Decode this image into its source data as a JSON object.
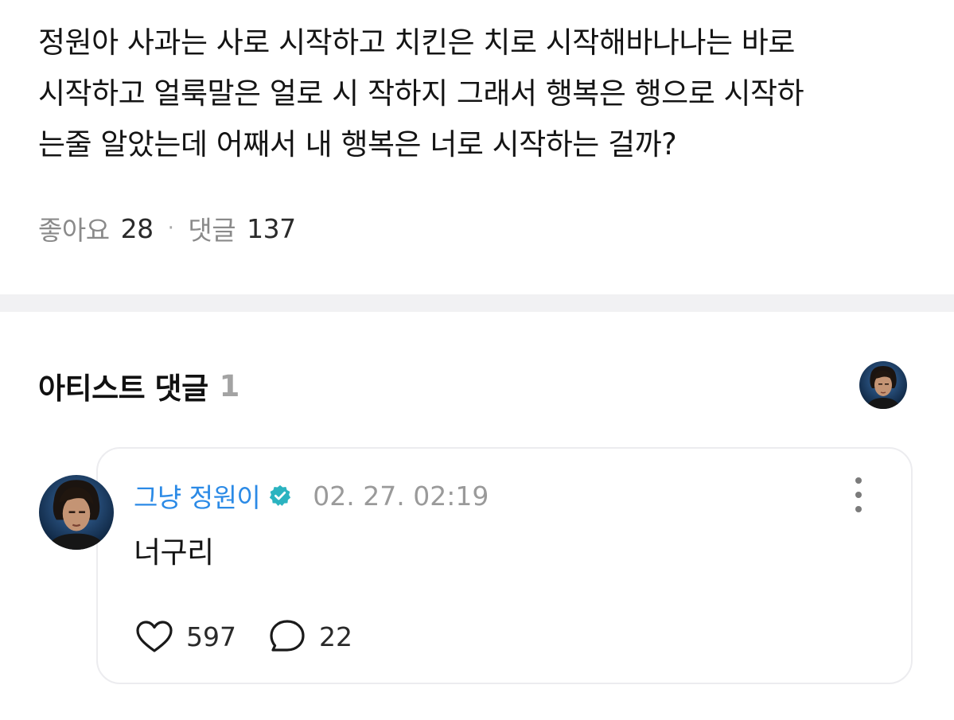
{
  "post": {
    "lines": [
      "정원아 사과는 사로 시작하고 치킨은 치로 시작해바나나는 바로",
      "시작하고 얼룩말은 얼로 시 작하지 그래서 행복은 행으로 시작하",
      "는줄 알았는데 어째서 내 행복은 너로 시작하는 걸까?"
    ],
    "likes_label": "좋아요",
    "likes_count": "28",
    "separator": "·",
    "comments_label": "댓글",
    "comments_count": "137"
  },
  "artist_section": {
    "title": "아티스트 댓글",
    "count": "1"
  },
  "comment": {
    "author": "그냥 정원이",
    "verified_icon": "verified-badge-icon",
    "timestamp": "02. 27. 02:19",
    "text": "너구리",
    "like_count": "597",
    "reply_count": "22"
  },
  "colors": {
    "author": "#2b8ae6",
    "verified": "#2bb3c0",
    "divider": "#f1f1f3",
    "muted": "#9a9a9a"
  }
}
